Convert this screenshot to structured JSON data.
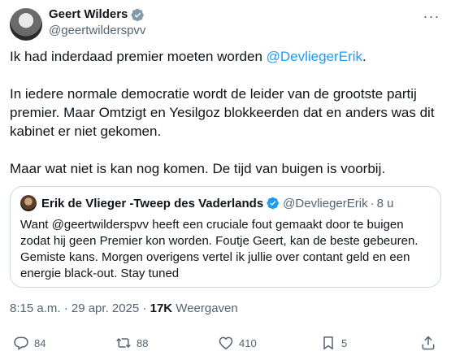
{
  "author": {
    "display_name": "Geert Wilders",
    "handle": "@geertwilderspvv"
  },
  "tweet": {
    "paragraph1_text": "Ik had inderdaad premier moeten worden ",
    "paragraph1_mention": "@DevliegerErik",
    "paragraph1_end": ".",
    "paragraph2": "In iedere normale democratie wordt de leider van de grootste partij premier. Maar Omtzigt en Yesilgoz blokkeerden dat en anders was dit kabinet er niet gekomen.",
    "paragraph3": "Maar wat niet is kan nog komen. De tijd van buigen is voorbij."
  },
  "quote": {
    "display_name": "Erik de Vlieger -Tweep des Vaderlands",
    "handle": "@DevliegerErik",
    "separator": "·",
    "time": "8 u",
    "text": "Want @geertwilderspvv heeft een cruciale fout gemaakt door te buigen zodat hij geen Premier kon worden.  Foutje Geert, kan de beste gebeuren.  Gemiste kans.  Morgen overigens vertel ik jullie over contant geld en een energie black-out. Stay tuned"
  },
  "meta": {
    "timestamp": "8:15 a.m. · 29 apr. 2025 · ",
    "views_count": "17K",
    "views_label": " Weergaven"
  },
  "actions": {
    "replies": "84",
    "reposts": "88",
    "likes": "410",
    "bookmarks": "5"
  },
  "colors": {
    "accent": "#1d9bf0",
    "secondary_text": "#536471"
  },
  "icons": [
    "verified-badge-icon",
    "more-icon",
    "reply-icon",
    "repost-icon",
    "like-icon",
    "bookmark-icon",
    "share-icon"
  ]
}
